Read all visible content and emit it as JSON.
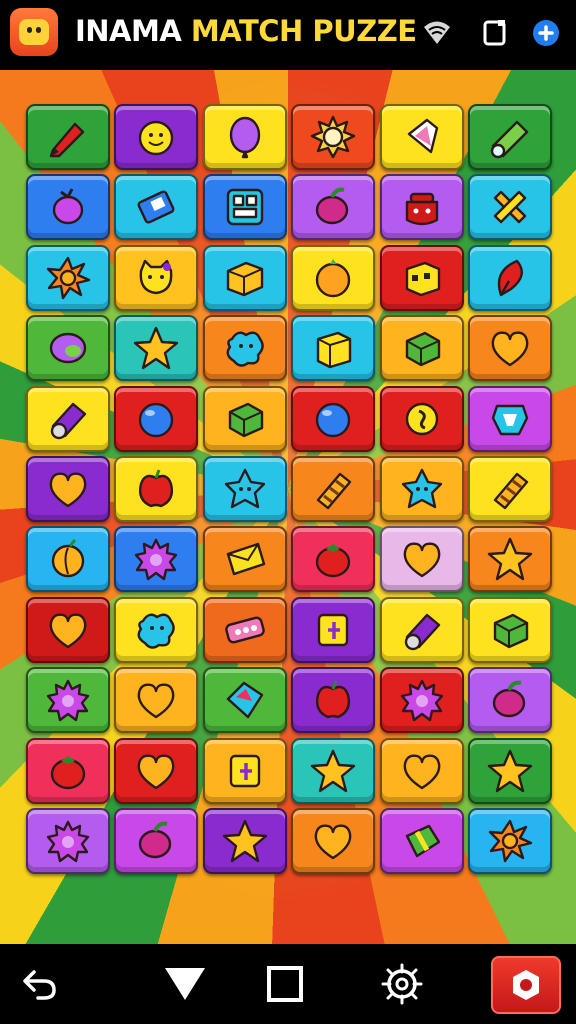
{
  "header": {
    "title_part1": "INAMA",
    "title_part2": "MATCH PUZZE",
    "icons": [
      "app-face-icon",
      "wifi-icon",
      "screen-icon",
      "add-icon"
    ]
  },
  "board": {
    "rows": [
      [
        {
          "bg": "#2ea33a",
          "icon": "crayon"
        },
        {
          "bg": "#8a2bd0",
          "icon": "smiley"
        },
        {
          "bg": "#ffe21f",
          "icon": "balloon"
        },
        {
          "bg": "#ee4a1d",
          "icon": "sun"
        },
        {
          "bg": "#ffe21f",
          "icon": "gem"
        },
        {
          "bg": "#2ea33a",
          "icon": "roll"
        }
      ],
      [
        {
          "bg": "#2f7ef0",
          "icon": "fruit"
        },
        {
          "bg": "#27c4e8",
          "icon": "battery"
        },
        {
          "bg": "#2f7ef0",
          "icon": "box-face"
        },
        {
          "bg": "#b45cf0",
          "icon": "berry"
        },
        {
          "bg": "#b45cf0",
          "icon": "pot"
        },
        {
          "bg": "#27c4e8",
          "icon": "cross"
        }
      ],
      [
        {
          "bg": "#27c4e8",
          "icon": "flower"
        },
        {
          "bg": "#ffc21f",
          "icon": "cat"
        },
        {
          "bg": "#27c4e8",
          "icon": "crate"
        },
        {
          "bg": "#ffe21f",
          "icon": "orange"
        },
        {
          "bg": "#e0201f",
          "icon": "cube-face"
        },
        {
          "bg": "#27c4e8",
          "icon": "leaf"
        }
      ],
      [
        {
          "bg": "#4fb83a",
          "icon": "oval"
        },
        {
          "bg": "#2bc4b8",
          "icon": "star"
        },
        {
          "bg": "#f7861d",
          "icon": "blob"
        },
        {
          "bg": "#27c4e8",
          "icon": "box"
        },
        {
          "bg": "#ffb31f",
          "icon": "cube"
        },
        {
          "bg": "#f7861d",
          "icon": "heart"
        }
      ],
      [
        {
          "bg": "#ffe21f",
          "icon": "cylinder"
        },
        {
          "bg": "#e0201f",
          "icon": "orb"
        },
        {
          "bg": "#ffb31f",
          "icon": "cube"
        },
        {
          "bg": "#e0201f",
          "icon": "orb"
        },
        {
          "bg": "#e0201f",
          "icon": "coin"
        },
        {
          "bg": "#c848e8",
          "icon": "badge"
        }
      ],
      [
        {
          "bg": "#8a2bd0",
          "icon": "heart"
        },
        {
          "bg": "#ffe21f",
          "icon": "apple"
        },
        {
          "bg": "#27c4e8",
          "icon": "star-face"
        },
        {
          "bg": "#f7861d",
          "icon": "candy"
        },
        {
          "bg": "#ffb31f",
          "icon": "star-face"
        },
        {
          "bg": "#ffe21f",
          "icon": "candy"
        }
      ],
      [
        {
          "bg": "#27b4f0",
          "icon": "peach"
        },
        {
          "bg": "#2f7ef0",
          "icon": "burst"
        },
        {
          "bg": "#f7861d",
          "icon": "envelope"
        },
        {
          "bg": "#f0305a",
          "icon": "tomato"
        },
        {
          "bg": "#e8b8e8",
          "icon": "heart"
        },
        {
          "bg": "#f7861d",
          "icon": "star"
        }
      ],
      [
        {
          "bg": "#d01a1a",
          "icon": "heart"
        },
        {
          "bg": "#ffe21f",
          "icon": "blob"
        },
        {
          "bg": "#f06a1d",
          "icon": "candy-bar"
        },
        {
          "bg": "#8a2bd0",
          "icon": "tag"
        },
        {
          "bg": "#ffe21f",
          "icon": "cylinder"
        },
        {
          "bg": "#ffe21f",
          "icon": "cube"
        }
      ],
      [
        {
          "bg": "#4fb83a",
          "icon": "burst"
        },
        {
          "bg": "#ffb31f",
          "icon": "heart"
        },
        {
          "bg": "#4fb83a",
          "icon": "diamond"
        },
        {
          "bg": "#8a2bd0",
          "icon": "apple"
        },
        {
          "bg": "#e0201f",
          "icon": "burst"
        },
        {
          "bg": "#b45cf0",
          "icon": "berry"
        }
      ],
      [
        {
          "bg": "#f0305a",
          "icon": "tomato"
        },
        {
          "bg": "#e0201f",
          "icon": "heart"
        },
        {
          "bg": "#ffb31f",
          "icon": "tag"
        },
        {
          "bg": "#2bc4b8",
          "icon": "star"
        },
        {
          "bg": "#ffb31f",
          "icon": "heart"
        },
        {
          "bg": "#2ea33a",
          "icon": "star"
        }
      ],
      [
        {
          "bg": "#b45cf0",
          "icon": "burst"
        },
        {
          "bg": "#c848e8",
          "icon": "berry"
        },
        {
          "bg": "#8a2bd0",
          "icon": "star"
        },
        {
          "bg": "#f7861d",
          "icon": "heart"
        },
        {
          "bg": "#c848e8",
          "icon": "candy-box"
        },
        {
          "bg": "#27b4f0",
          "icon": "flower"
        }
      ]
    ]
  },
  "icon_colors": {
    "crayon": "#e0201f",
    "smiley": "#ffe21f",
    "balloon": "#b45cf0",
    "sun": "#ffd23a",
    "gem": "#f07ab8",
    "roll": "#7bd04a",
    "fruit": "#c848e8",
    "battery": "#2f7ef0",
    "box-face": "#27c4e8",
    "berry": "#d02a8a",
    "pot": "#d01a1a",
    "cross": "#ffb31f",
    "flower": "#f7861d",
    "cat": "#ffe21f",
    "crate": "#ffc21f",
    "orange": "#ffa21f",
    "cube-face": "#ffe21f",
    "leaf": "#e0201f",
    "oval": "#b45cf0",
    "star": "#ffc21f",
    "blob": "#27c4e8",
    "box": "#ffe21f",
    "cube": "#4fb83a",
    "heart": "#ffb31f",
    "cylinder": "#8a2bd0",
    "orb": "#2f7ef0",
    "coin": "#ffe21f",
    "badge": "#27c4e8",
    "apple": "#e0201f",
    "star-face": "#27c4e8",
    "candy": "#ffb31f",
    "peach": "#ffb31f",
    "burst": "#c848e8",
    "envelope": "#ffe21f",
    "tomato": "#e0201f",
    "candy-bar": "#f07ab8",
    "tag": "#ffe21f",
    "diamond": "#f0305a",
    "candy-box": "#4fb83a"
  },
  "navbar": {
    "icons": [
      "back-icon",
      "home-triangle-icon",
      "recents-square-icon",
      "target-icon",
      "settings-icon"
    ]
  }
}
